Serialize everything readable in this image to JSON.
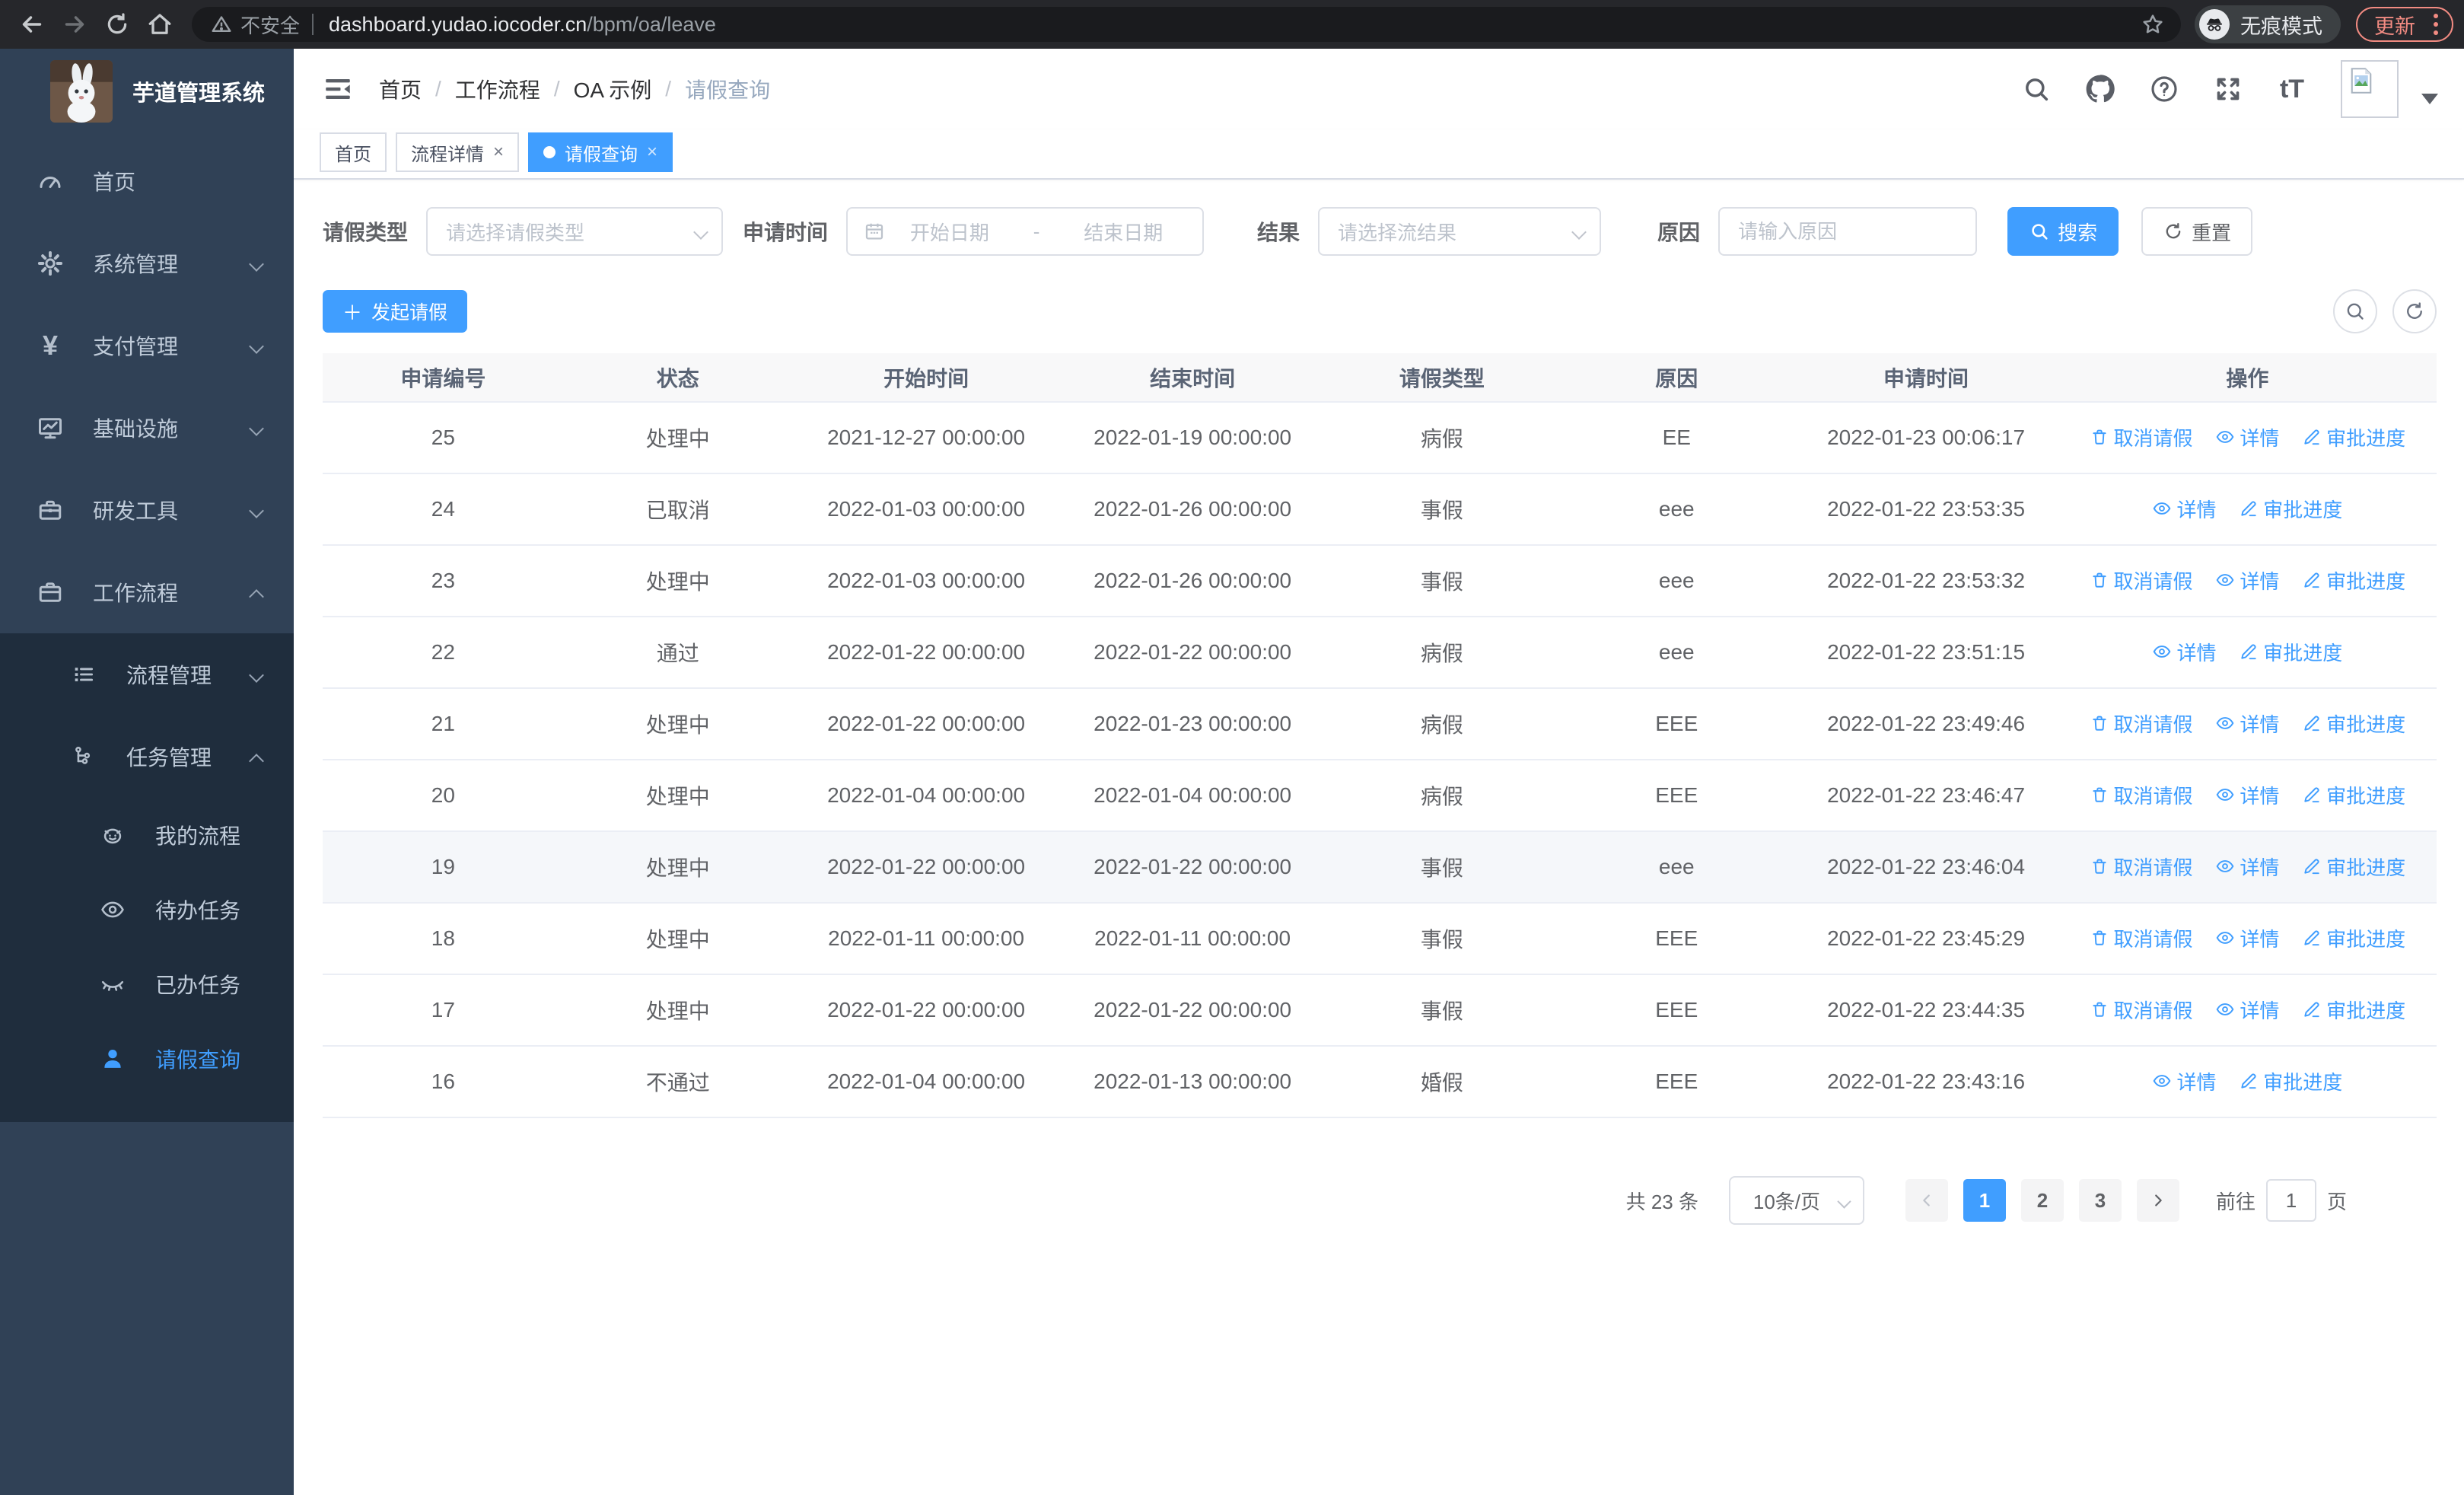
{
  "browser": {
    "security_label": "不安全",
    "url_host": "dashboard.yudao.iocoder.cn",
    "url_path": "/bpm/oa/leave",
    "incognito_label": "无痕模式",
    "update_label": "更新"
  },
  "icons": {
    "plus": "＋",
    "close": "×",
    "question": "?",
    "font_size": "tT"
  },
  "sidebar": {
    "title": "芋道管理系统",
    "items": [
      {
        "label": "首页"
      },
      {
        "label": "系统管理"
      },
      {
        "label": "支付管理"
      },
      {
        "label": "基础设施"
      },
      {
        "label": "研发工具"
      },
      {
        "label": "工作流程"
      },
      {
        "label": "流程管理"
      },
      {
        "label": "任务管理"
      },
      {
        "label": "我的流程"
      },
      {
        "label": "待办任务"
      },
      {
        "label": "已办任务"
      },
      {
        "label": "请假查询"
      }
    ]
  },
  "breadcrumb": [
    "首页",
    "工作流程",
    "OA 示例",
    "请假查询"
  ],
  "tabs": [
    {
      "label": "首页",
      "closable": false,
      "active": false
    },
    {
      "label": "流程详情",
      "closable": true,
      "active": false
    },
    {
      "label": "请假查询",
      "closable": true,
      "active": true
    }
  ],
  "filters": {
    "leave_type_label": "请假类型",
    "leave_type_placeholder": "请选择请假类型",
    "apply_time_label": "申请时间",
    "date_start_placeholder": "开始日期",
    "date_separator": "-",
    "date_end_placeholder": "结束日期",
    "result_label": "结果",
    "result_placeholder": "请选择流结果",
    "reason_label": "原因",
    "reason_placeholder": "请输入原因",
    "search_label": "搜索",
    "reset_label": "重置"
  },
  "toolbar": {
    "create_label": "发起请假"
  },
  "table": {
    "headers": [
      "申请编号",
      "状态",
      "开始时间",
      "结束时间",
      "请假类型",
      "原因",
      "申请时间",
      "操作"
    ],
    "rows": [
      {
        "id": "25",
        "status": "处理中",
        "start": "2021-12-27 00:00:00",
        "end": "2022-01-19 00:00:00",
        "type": "病假",
        "reason": "EE",
        "apply": "2022-01-23 00:06:17",
        "can_cancel": true,
        "highlight": false
      },
      {
        "id": "24",
        "status": "已取消",
        "start": "2022-01-03 00:00:00",
        "end": "2022-01-26 00:00:00",
        "type": "事假",
        "reason": "eee",
        "apply": "2022-01-22 23:53:35",
        "can_cancel": false,
        "highlight": false
      },
      {
        "id": "23",
        "status": "处理中",
        "start": "2022-01-03 00:00:00",
        "end": "2022-01-26 00:00:00",
        "type": "事假",
        "reason": "eee",
        "apply": "2022-01-22 23:53:32",
        "can_cancel": true,
        "highlight": false
      },
      {
        "id": "22",
        "status": "通过",
        "start": "2022-01-22 00:00:00",
        "end": "2022-01-22 00:00:00",
        "type": "病假",
        "reason": "eee",
        "apply": "2022-01-22 23:51:15",
        "can_cancel": false,
        "highlight": false
      },
      {
        "id": "21",
        "status": "处理中",
        "start": "2022-01-22 00:00:00",
        "end": "2022-01-23 00:00:00",
        "type": "病假",
        "reason": "EEE",
        "apply": "2022-01-22 23:49:46",
        "can_cancel": true,
        "highlight": false
      },
      {
        "id": "20",
        "status": "处理中",
        "start": "2022-01-04 00:00:00",
        "end": "2022-01-04 00:00:00",
        "type": "病假",
        "reason": "EEE",
        "apply": "2022-01-22 23:46:47",
        "can_cancel": true,
        "highlight": false
      },
      {
        "id": "19",
        "status": "处理中",
        "start": "2022-01-22 00:00:00",
        "end": "2022-01-22 00:00:00",
        "type": "事假",
        "reason": "eee",
        "apply": "2022-01-22 23:46:04",
        "can_cancel": true,
        "highlight": true
      },
      {
        "id": "18",
        "status": "处理中",
        "start": "2022-01-11 00:00:00",
        "end": "2022-01-11 00:00:00",
        "type": "事假",
        "reason": "EEE",
        "apply": "2022-01-22 23:45:29",
        "can_cancel": true,
        "highlight": false
      },
      {
        "id": "17",
        "status": "处理中",
        "start": "2022-01-22 00:00:00",
        "end": "2022-01-22 00:00:00",
        "type": "事假",
        "reason": "EEE",
        "apply": "2022-01-22 23:44:35",
        "can_cancel": true,
        "highlight": false
      },
      {
        "id": "16",
        "status": "不通过",
        "start": "2022-01-04 00:00:00",
        "end": "2022-01-13 00:00:00",
        "type": "婚假",
        "reason": "EEE",
        "apply": "2022-01-22 23:43:16",
        "can_cancel": false,
        "highlight": false
      }
    ]
  },
  "actions": {
    "cancel": "取消请假",
    "detail": "详情",
    "progress": "审批进度"
  },
  "pagination": {
    "total": "共 23 条",
    "page_size": "10条/页",
    "pages": [
      "1",
      "2",
      "3"
    ],
    "active_page": "1",
    "goto_label": "前往",
    "goto_value": "1",
    "unit_label": "页"
  },
  "colors": {
    "primary": "#409eff",
    "sidebar_bg": "#304156",
    "submenu_bg": "#1f2d3d",
    "update_accent": "#f28b82"
  }
}
